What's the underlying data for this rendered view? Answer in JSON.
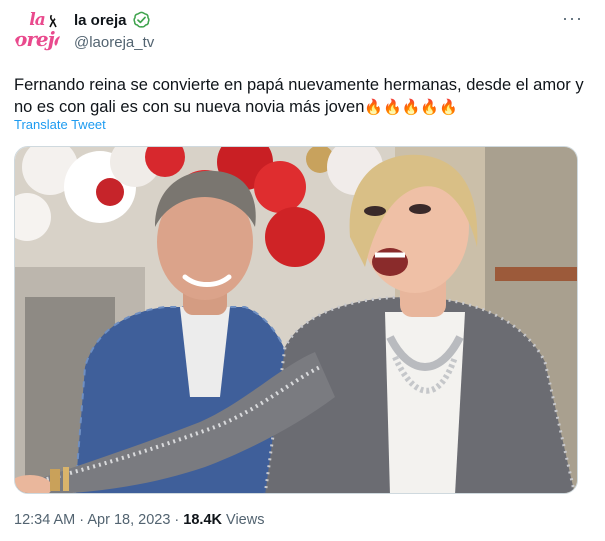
{
  "account": {
    "display_name": "la oreja",
    "handle": "@laoreja_tv",
    "avatar_logo_line1": "la",
    "avatar_logo_line2": "oreja",
    "verified_icon": "verified-badge-icon",
    "more_icon": "more-options-icon",
    "more_label": "···"
  },
  "tweet": {
    "text": "Fernando reina se convierte en papá nuevamente hermanas, desde el amor y no es con gali es con su nueva novia más joven",
    "emojis": "🔥🔥🔥🔥🔥",
    "translate_label": "Translate Tweet"
  },
  "media": {
    "type": "photo",
    "image_icon": "tweet-photo"
  },
  "footer": {
    "time": "12:34 AM",
    "separator1": " · ",
    "date": "Apr 18, 2023",
    "separator2": " · ",
    "views_count": "18.4K",
    "views_label": " Views"
  },
  "colors": {
    "link": "#1d9bf0",
    "muted": "#536471",
    "text": "#0f1419",
    "logo_pink": "#e94a8d",
    "verified_green": "#3fa34d"
  }
}
